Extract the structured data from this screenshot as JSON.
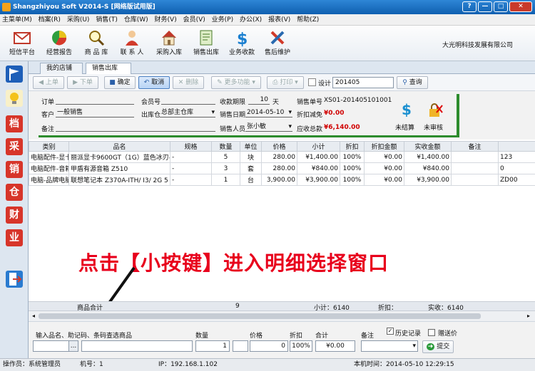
{
  "window": {
    "title": "Shangzhiyou Soft V2014-S [网络版试用版]",
    "btn_help": "?",
    "btn_min": "—",
    "btn_max": "□",
    "btn_close": "✕"
  },
  "menu": [
    "主菜单(M)",
    "档案(R)",
    "采购(U)",
    "销售(T)",
    "仓库(W)",
    "财务(V)",
    "会员(V)",
    "业务(P)",
    "办公(X)",
    "报表(V)",
    "帮助(Z)"
  ],
  "toolbar": [
    {
      "label": "短信平台",
      "icon": "envelope-icon"
    },
    {
      "label": "经营报告",
      "icon": "pie-chart-icon"
    },
    {
      "label": "商 品 库",
      "icon": "magnifier-icon"
    },
    {
      "label": "联 系 人",
      "icon": "person-icon"
    },
    {
      "label": "采购入库",
      "icon": "house-icon"
    },
    {
      "label": "销售出库",
      "icon": "document-icon"
    },
    {
      "label": "业务收款",
      "icon": "dollar-icon"
    },
    {
      "label": "售后维护",
      "icon": "tools-icon"
    }
  ],
  "company": "大光明科技发展有限公司",
  "leftbar": [
    {
      "icon": "flag-icon",
      "text": ""
    },
    {
      "icon": "bulb-icon",
      "text": ""
    },
    {
      "icon": "dang-icon",
      "text": "档"
    },
    {
      "icon": "cai-icon",
      "text": "采"
    },
    {
      "icon": "xiao-icon",
      "text": "销"
    },
    {
      "icon": "cang-icon",
      "text": "仓"
    },
    {
      "icon": "cai2-icon",
      "text": "财"
    },
    {
      "icon": "ye-icon",
      "text": "业"
    },
    {
      "icon": "exit-icon",
      "text": ""
    }
  ],
  "tabs": {
    "home": "我的店铺",
    "sales": "销售出库",
    "close": "✕"
  },
  "buttons": {
    "prev": "上单",
    "next": "下单",
    "confirm": "确定",
    "cancel": "取消",
    "delete": "删除",
    "more": "更多功能",
    "print": "打印",
    "design": "设计",
    "search_value": "201405",
    "search": "查询"
  },
  "form": {
    "order_label": "订单",
    "order": "",
    "member_label": "会员号",
    "member": "",
    "term_label": "收款期限",
    "term": "10",
    "term_unit": "天",
    "docno_label": "销售单号",
    "docno": "XS01-201405101001",
    "customer_label": "客户",
    "customer": "一般销售",
    "warehouse_label": "出库仓",
    "warehouse": "总部主仓库",
    "date_label": "销售日期",
    "date": "2014-05-10",
    "discount_label": "折扣减免",
    "discount": "¥0.00",
    "note_label": "备注",
    "note": "",
    "seller_label": "销售人员",
    "seller": "张小敏",
    "receivable_label": "应收总款",
    "receivable": "¥6,140.00",
    "unsettled": "未结算",
    "unaudited": "未审核"
  },
  "grid": {
    "headers": [
      "类别",
      "品名",
      "规格",
      "数量",
      "单位",
      "价格",
      "小计",
      "折扣",
      "折扣金额",
      "实收金额",
      "备注",
      ""
    ],
    "rows": [
      [
        "电脑配件-显卡",
        "丽派显卡9600GT（1G）蓝色冰刃-",
        "-",
        "5",
        "块",
        "280.00",
        "¥1,400.00",
        "100%",
        "¥0.00",
        "¥1,400.00",
        "",
        "123"
      ],
      [
        "电脑配件-音箱",
        "甲盾有源音箱 Z510",
        "-",
        "3",
        "套",
        "280.00",
        "¥840.00",
        "100%",
        "¥0.00",
        "¥840.00",
        "",
        "0"
      ],
      [
        "电脑-品牌电脑",
        "联想笔记本 Z370A-ITH/ I3/ 2G 5",
        "-",
        "1",
        "台",
        "3,900.00",
        "¥3,900.00",
        "100%",
        "¥0.00",
        "¥3,900.00",
        "",
        "ZD00"
      ]
    ]
  },
  "summary": {
    "label": "商品合计",
    "qty": "9",
    "subtotal": "小计：6140",
    "disc": "折扣：",
    "actual": "实收：6140"
  },
  "overlay": "点击【小按键】进入明细选择窗口",
  "entry": {
    "name_label": "输入品名、助记码、条码查选商品",
    "dots": "...",
    "qty_label": "数量",
    "qty": "1",
    "price_label": "价格",
    "price": "0",
    "disc_label": "折扣",
    "disc": "100%",
    "total_label": "合计",
    "total": "¥0.00",
    "note_label": "备注",
    "history": "历史记录",
    "gift": "赠送价",
    "submit": "提交"
  },
  "status": {
    "operator": "操作员：系统管理员",
    "machine": "机号：1",
    "ip": "IP：192.168.1.102",
    "time": "本机时间：2014-05-10 12:29:15"
  }
}
